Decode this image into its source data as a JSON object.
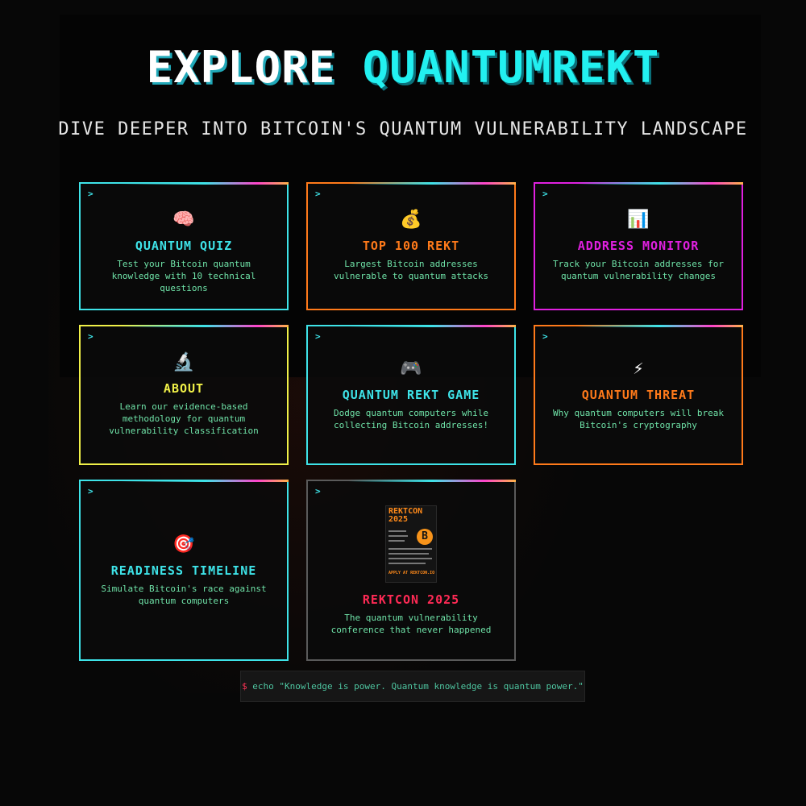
{
  "header": {
    "title_part1": "EXPLORE ",
    "title_part2": "QUANTUMREKT",
    "subtitle": "DIVE DEEPER INTO BITCOIN'S QUANTUM VULNERABILITY LANDSCAPE"
  },
  "prompt_symbol": ">",
  "cards": [
    {
      "icon": "🧠",
      "icon_name": "brain-icon",
      "title": "QUANTUM QUIZ",
      "description": "Test your Bitcoin quantum knowledge with 10 technical questions",
      "color": "#3ee3e8"
    },
    {
      "icon": "💰",
      "icon_name": "money-bag-icon",
      "title": "TOP 100 REKT",
      "description": "Largest Bitcoin addresses vulnerable to quantum attacks",
      "color": "#ff7a1a"
    },
    {
      "icon": "📊",
      "icon_name": "bar-chart-icon",
      "title": "ADDRESS MONITOR",
      "description": "Track your Bitcoin addresses for quantum vulnerability changes",
      "color": "#e020e0"
    },
    {
      "icon": "🔬",
      "icon_name": "microscope-icon",
      "title": "ABOUT",
      "description": "Learn our evidence-based methodology for quantum vulnerability classification",
      "color": "#f0f048"
    },
    {
      "icon": "🎮",
      "icon_name": "game-controller-icon",
      "title": "QUANTUM REKT GAME",
      "description": "Dodge quantum computers while collecting Bitcoin addresses!",
      "color": "#3ee3e8"
    },
    {
      "icon": "⚡",
      "icon_name": "lightning-icon",
      "title": "QUANTUM THREAT",
      "description": "Why quantum computers will break Bitcoin's cryptography",
      "color": "#ff7a1a"
    },
    {
      "icon": "🎯",
      "icon_name": "target-icon",
      "title": "READINESS TIMELINE",
      "description": "Simulate Bitcoin's race against quantum computers",
      "color": "#3ee3e8"
    },
    {
      "icon": "",
      "icon_name": "rektcon-poster",
      "title": "REKTCON 2025",
      "description": "The quantum vulnerability conference that never happened",
      "color": "#ff2a55"
    }
  ],
  "poster": {
    "title_line1": "REKTCON",
    "title_line2": "2025",
    "btc_symbol": "B",
    "apply": "APPLY AT REKTCON.IO"
  },
  "terminal": {
    "symbol": "$",
    "command": " echo \"Knowledge is power. Quantum knowledge is quantum power.\""
  }
}
